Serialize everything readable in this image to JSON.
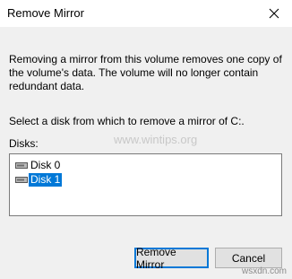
{
  "window": {
    "title": "Remove Mirror",
    "close_icon": "close-icon"
  },
  "content": {
    "description": "Removing a mirror from this volume removes one copy of the volume's data. The volume will no longer contain redundant data.",
    "prompt": "Select a disk from which to remove a mirror of C:.",
    "disks_label": "Disks:",
    "disks": [
      {
        "label": "Disk 0",
        "icon": "disk-icon",
        "selected": false
      },
      {
        "label": "Disk 1",
        "icon": "disk-icon",
        "selected": true
      }
    ]
  },
  "buttons": {
    "remove_mirror": "Remove Mirror",
    "cancel": "Cancel"
  },
  "watermark": "www.wintips.org",
  "site_mark": "wsxdn.com",
  "colors": {
    "selection": "#0078d7",
    "dialog_bg": "#f0f0f0",
    "button_bg": "#e1e1e1"
  }
}
